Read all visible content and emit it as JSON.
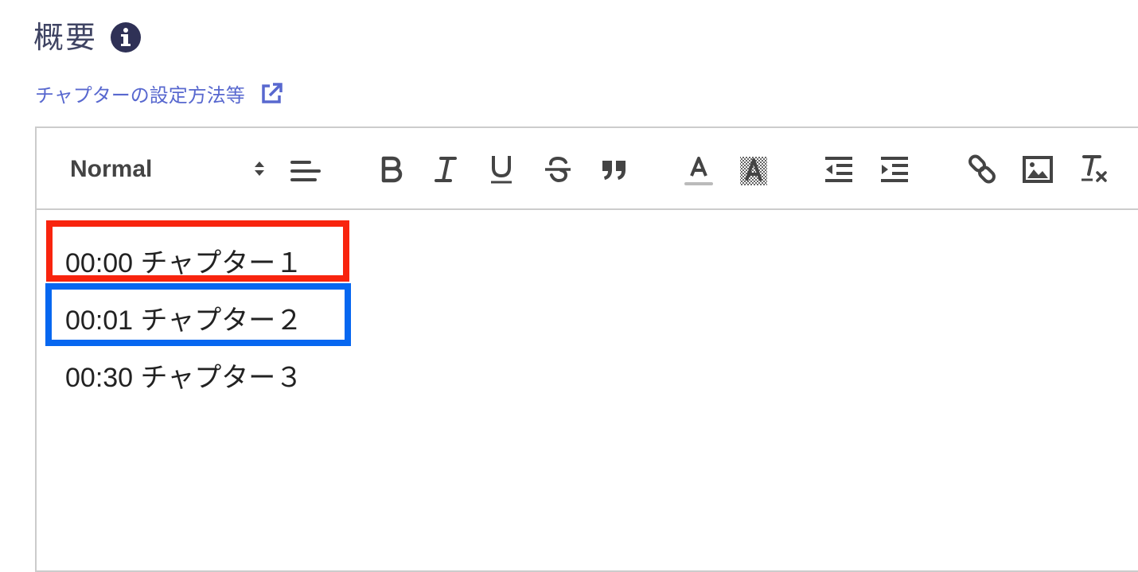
{
  "section": {
    "title": "概要",
    "help_link_text": "チャプターの設定方法等"
  },
  "toolbar": {
    "header_select_value": "Normal",
    "buttons": [
      "align-icon",
      "bold-icon",
      "italic-icon",
      "underline-icon",
      "strike-icon",
      "blockquote-icon",
      "text-color-icon",
      "background-color-icon",
      "outdent-icon",
      "indent-icon",
      "link-icon",
      "image-icon",
      "clear-format-icon"
    ]
  },
  "editor": {
    "lines": [
      "00:00 チャプター１",
      "00:01 チャプター２",
      "00:30 チャプター３"
    ]
  },
  "colors": {
    "highlight_red": "#f8240e",
    "highlight_blue": "#0767f0",
    "link": "#5868cf",
    "title": "#3f4463"
  }
}
